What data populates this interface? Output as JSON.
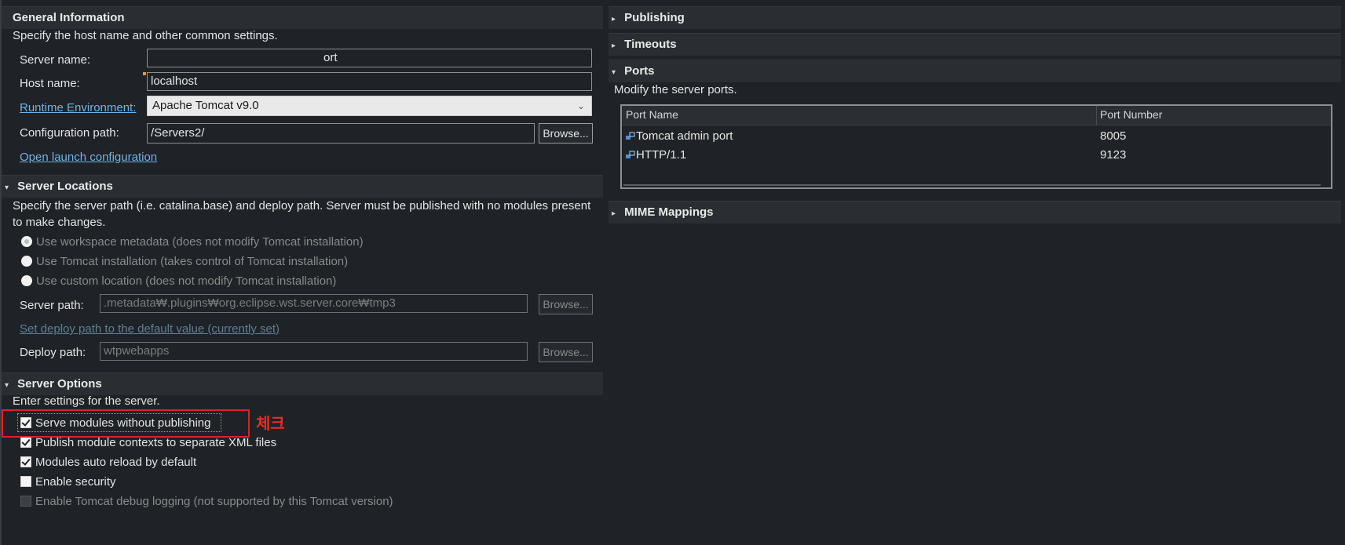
{
  "general": {
    "title": "General Information",
    "description": "Specify the host name and other common settings.",
    "server_name_label": "Server name:",
    "server_name_value": "ort",
    "host_name_label": "Host name:",
    "host_name_value": "localhost",
    "runtime_label": "Runtime Environment:",
    "runtime_value": "Apache Tomcat v9.0",
    "config_path_label": "Configuration path:",
    "config_path_value": "/Servers2/",
    "browse_label": "Browse...",
    "open_launch_label": "Open launch configuration"
  },
  "locations": {
    "title": "Server Locations",
    "description": "Specify the server path (i.e. catalina.base) and deploy path. Server must be published with no modules present to make changes.",
    "radios": [
      {
        "label": "Use workspace metadata (does not modify Tomcat installation)",
        "selected": true
      },
      {
        "label": "Use Tomcat installation (takes control of Tomcat installation)",
        "selected": false
      },
      {
        "label": "Use custom location (does not modify Tomcat installation)",
        "selected": false
      }
    ],
    "server_path_label": "Server path:",
    "server_path_value": ".metadata₩.plugins₩org.eclipse.wst.server.core₩tmp3",
    "set_deploy_link": "Set deploy path to the default value (currently set)",
    "deploy_path_label": "Deploy path:",
    "deploy_path_value": "wtpwebapps",
    "browse_label": "Browse..."
  },
  "options": {
    "title": "Server Options",
    "description": "Enter settings for the server.",
    "checkboxes": [
      {
        "label": "Serve modules without publishing",
        "checked": true,
        "enabled": true
      },
      {
        "label": "Publish module contexts to separate XML files",
        "checked": true,
        "enabled": true
      },
      {
        "label": "Modules auto reload by default",
        "checked": true,
        "enabled": true
      },
      {
        "label": "Enable security",
        "checked": false,
        "enabled": true
      },
      {
        "label": "Enable Tomcat debug logging (not supported by this Tomcat version)",
        "checked": false,
        "enabled": false
      }
    ],
    "annotation_text": "체크",
    "annotation_color": "#e0202a"
  },
  "right": {
    "publishing_title": "Publishing",
    "timeouts_title": "Timeouts",
    "ports_title": "Ports",
    "ports_description": "Modify the server ports.",
    "ports_columns": [
      "Port Name",
      "Port Number"
    ],
    "ports_rows": [
      {
        "name": "Tomcat admin port",
        "number": "8005"
      },
      {
        "name": "HTTP/1.1",
        "number": "9123"
      }
    ],
    "mime_title": "MIME Mappings"
  },
  "icons": {
    "expanded": "triangle-down-icon",
    "collapsed": "triangle-right-icon",
    "port": "port-icon"
  },
  "colors": {
    "background": "#1f2226",
    "link": "#6fb3e6",
    "highlight": "#e0202a"
  }
}
